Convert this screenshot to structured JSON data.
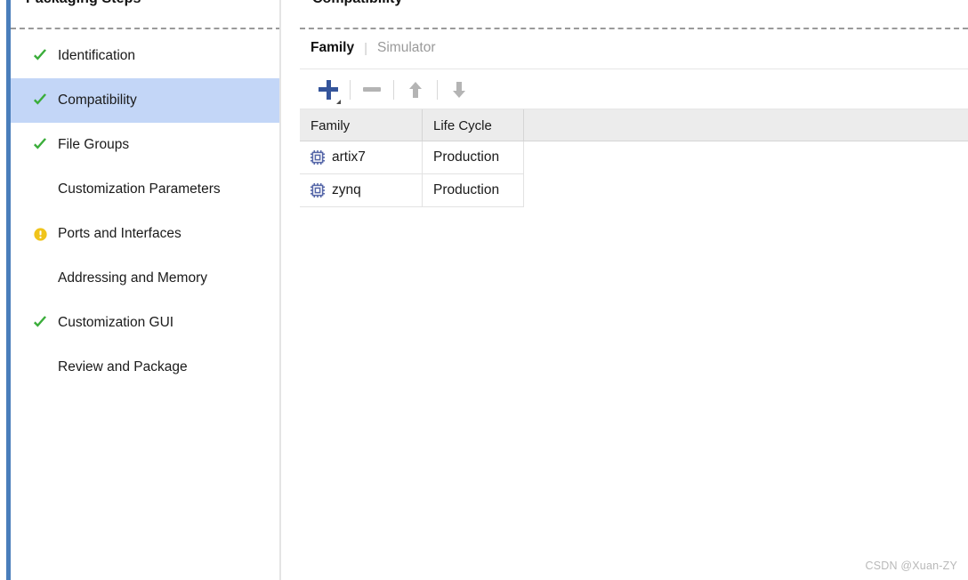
{
  "sidebar": {
    "title": "Packaging Steps",
    "items": [
      {
        "label": "Identification",
        "status": "check",
        "selected": false
      },
      {
        "label": "Compatibility",
        "status": "check",
        "selected": true
      },
      {
        "label": "File Groups",
        "status": "check",
        "selected": false
      },
      {
        "label": "Customization Parameters",
        "status": "none",
        "selected": false
      },
      {
        "label": "Ports and Interfaces",
        "status": "warning",
        "selected": false
      },
      {
        "label": "Addressing and Memory",
        "status": "none",
        "selected": false
      },
      {
        "label": "Customization GUI",
        "status": "check",
        "selected": false
      },
      {
        "label": "Review and Package",
        "status": "none",
        "selected": false
      }
    ]
  },
  "main": {
    "title": "Compatibility",
    "tabs": [
      {
        "label": "Family",
        "active": true
      },
      {
        "label": "Simulator",
        "active": false
      }
    ],
    "tab_divider": "|",
    "toolbar": [
      {
        "name": "add-button",
        "icon": "plus-icon",
        "enabled": true
      },
      {
        "name": "remove-button",
        "icon": "minus-icon",
        "enabled": false
      },
      {
        "name": "move-up-button",
        "icon": "arrow-up-icon",
        "enabled": false
      },
      {
        "name": "move-down-button",
        "icon": "arrow-down-icon",
        "enabled": false
      }
    ],
    "table": {
      "columns": [
        "Family",
        "Life Cycle"
      ],
      "rows": [
        {
          "family": "artix7",
          "life_cycle": "Production",
          "icon": "chip-icon"
        },
        {
          "family": "zynq",
          "life_cycle": "Production",
          "icon": "chip-icon"
        }
      ]
    }
  },
  "watermark": "CSDN @Xuan-ZY",
  "colors": {
    "accent_bar": "#4a7ebb",
    "selection": "#c3d6f7",
    "check_green": "#3aad3a",
    "warning_yellow": "#f0c41b",
    "plus_blue": "#35559b",
    "chip_blue": "#5566a8",
    "header_gray": "#ececec"
  }
}
